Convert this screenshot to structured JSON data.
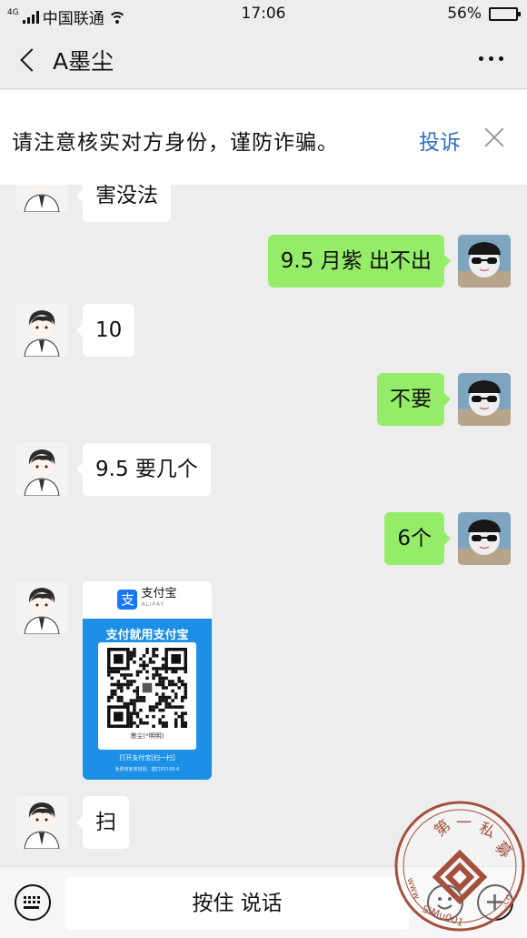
{
  "status_bar": {
    "network": "4G",
    "carrier": "中国联通",
    "time": "17:06",
    "battery": "56%",
    "battery_level": 0.56
  },
  "header": {
    "title": "A墨尘"
  },
  "notice": {
    "text": "请注意核实对方身份，谨防诈骗。",
    "action": "投诉"
  },
  "messages": [
    {
      "side": "left",
      "text": "害没法"
    },
    {
      "side": "right",
      "text": "9.5 月紫 出不出"
    },
    {
      "side": "left",
      "text": "10"
    },
    {
      "side": "right",
      "text": "不要"
    },
    {
      "side": "left",
      "text": "9.5 要几个"
    },
    {
      "side": "right",
      "text": "6个"
    },
    {
      "side": "left",
      "type": "alipay-qr"
    },
    {
      "side": "left",
      "text": "扫"
    }
  ],
  "alipay_card": {
    "brand": "支付宝",
    "brand_en": "ALIPAY",
    "heading": "支付就用支付宝",
    "name": "墨尘(*明明)",
    "footer": "打开支付宝[扫一扫]",
    "footnote": "免费商家收钱码：拨打95188-6"
  },
  "input_bar": {
    "hold_to_talk": "按住 说话"
  },
  "watermark": {
    "text": "第一私募",
    "url": "www.SiMu001.cn"
  },
  "colors": {
    "background": "#ededed",
    "bubble_mine": "#95ec69",
    "bubble_other": "#ffffff",
    "link": "#2f6ec6",
    "alipay_blue": "#1c8fe6"
  }
}
